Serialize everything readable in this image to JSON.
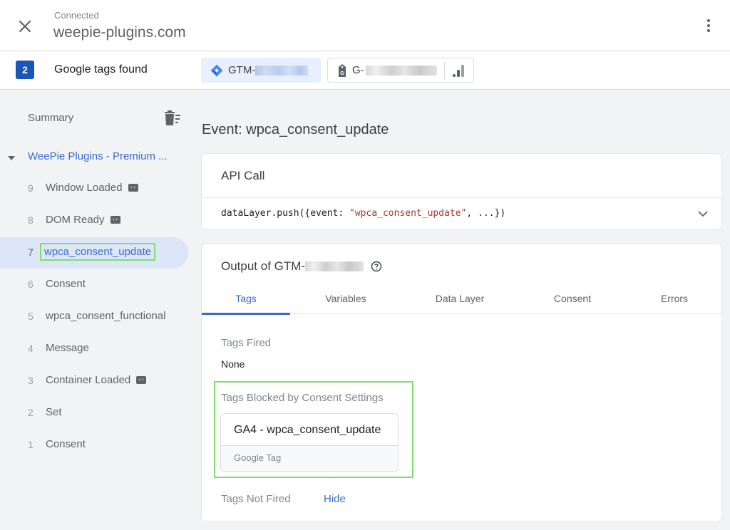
{
  "header": {
    "status": "Connected",
    "domain": "weepie-plugins.com"
  },
  "tagbar": {
    "count": "2",
    "label": "Google tags found",
    "chips": [
      {
        "id_prefix": "GTM-",
        "icon": "gtm-diamond-icon",
        "active": true
      },
      {
        "id_prefix": "G-",
        "icon": "google-tag-icon",
        "extra_icon": "analytics-bars-icon",
        "active": false
      }
    ]
  },
  "sidebar": {
    "summary_label": "Summary",
    "container_name": "WeePie Plugins - Premium ...",
    "events": [
      {
        "num": "9",
        "label": "Window Loaded",
        "code_badge": true
      },
      {
        "num": "8",
        "label": "DOM Ready",
        "code_badge": true
      },
      {
        "num": "7",
        "label": "wpca_consent_update",
        "code_badge": false,
        "active": true
      },
      {
        "num": "6",
        "label": "Consent",
        "code_badge": false
      },
      {
        "num": "5",
        "label": "wpca_consent_functional",
        "code_badge": false
      },
      {
        "num": "4",
        "label": "Message",
        "code_badge": false
      },
      {
        "num": "3",
        "label": "Container Loaded",
        "code_badge": true
      },
      {
        "num": "2",
        "label": "Set",
        "code_badge": false
      },
      {
        "num": "1",
        "label": "Consent",
        "code_badge": false
      }
    ]
  },
  "main": {
    "event_title": "Event: wpca_consent_update",
    "api_card": {
      "title": "API Call",
      "code_prefix": "dataLayer.push({event: ",
      "code_string": "\"wpca_consent_update\"",
      "code_suffix": ", ...})"
    },
    "output_card": {
      "title_prefix": "Output of GTM-",
      "tabs": [
        "Tags",
        "Variables",
        "Data Layer",
        "Consent",
        "Errors"
      ],
      "active_tab": "Tags",
      "tags_fired_label": "Tags Fired",
      "tags_fired_value": "None",
      "blocked_label": "Tags Blocked by Consent Settings",
      "blocked_tag": {
        "name": "GA4 - wpca_consent_update",
        "type": "Google Tag"
      },
      "not_fired_label": "Tags Not Fired",
      "hide_label": "Hide"
    }
  },
  "colors": {
    "accent": "#3a6bc9",
    "badge": "#1a56b8",
    "highlight": "#7ee06b",
    "code_string": "#a33a2b"
  }
}
